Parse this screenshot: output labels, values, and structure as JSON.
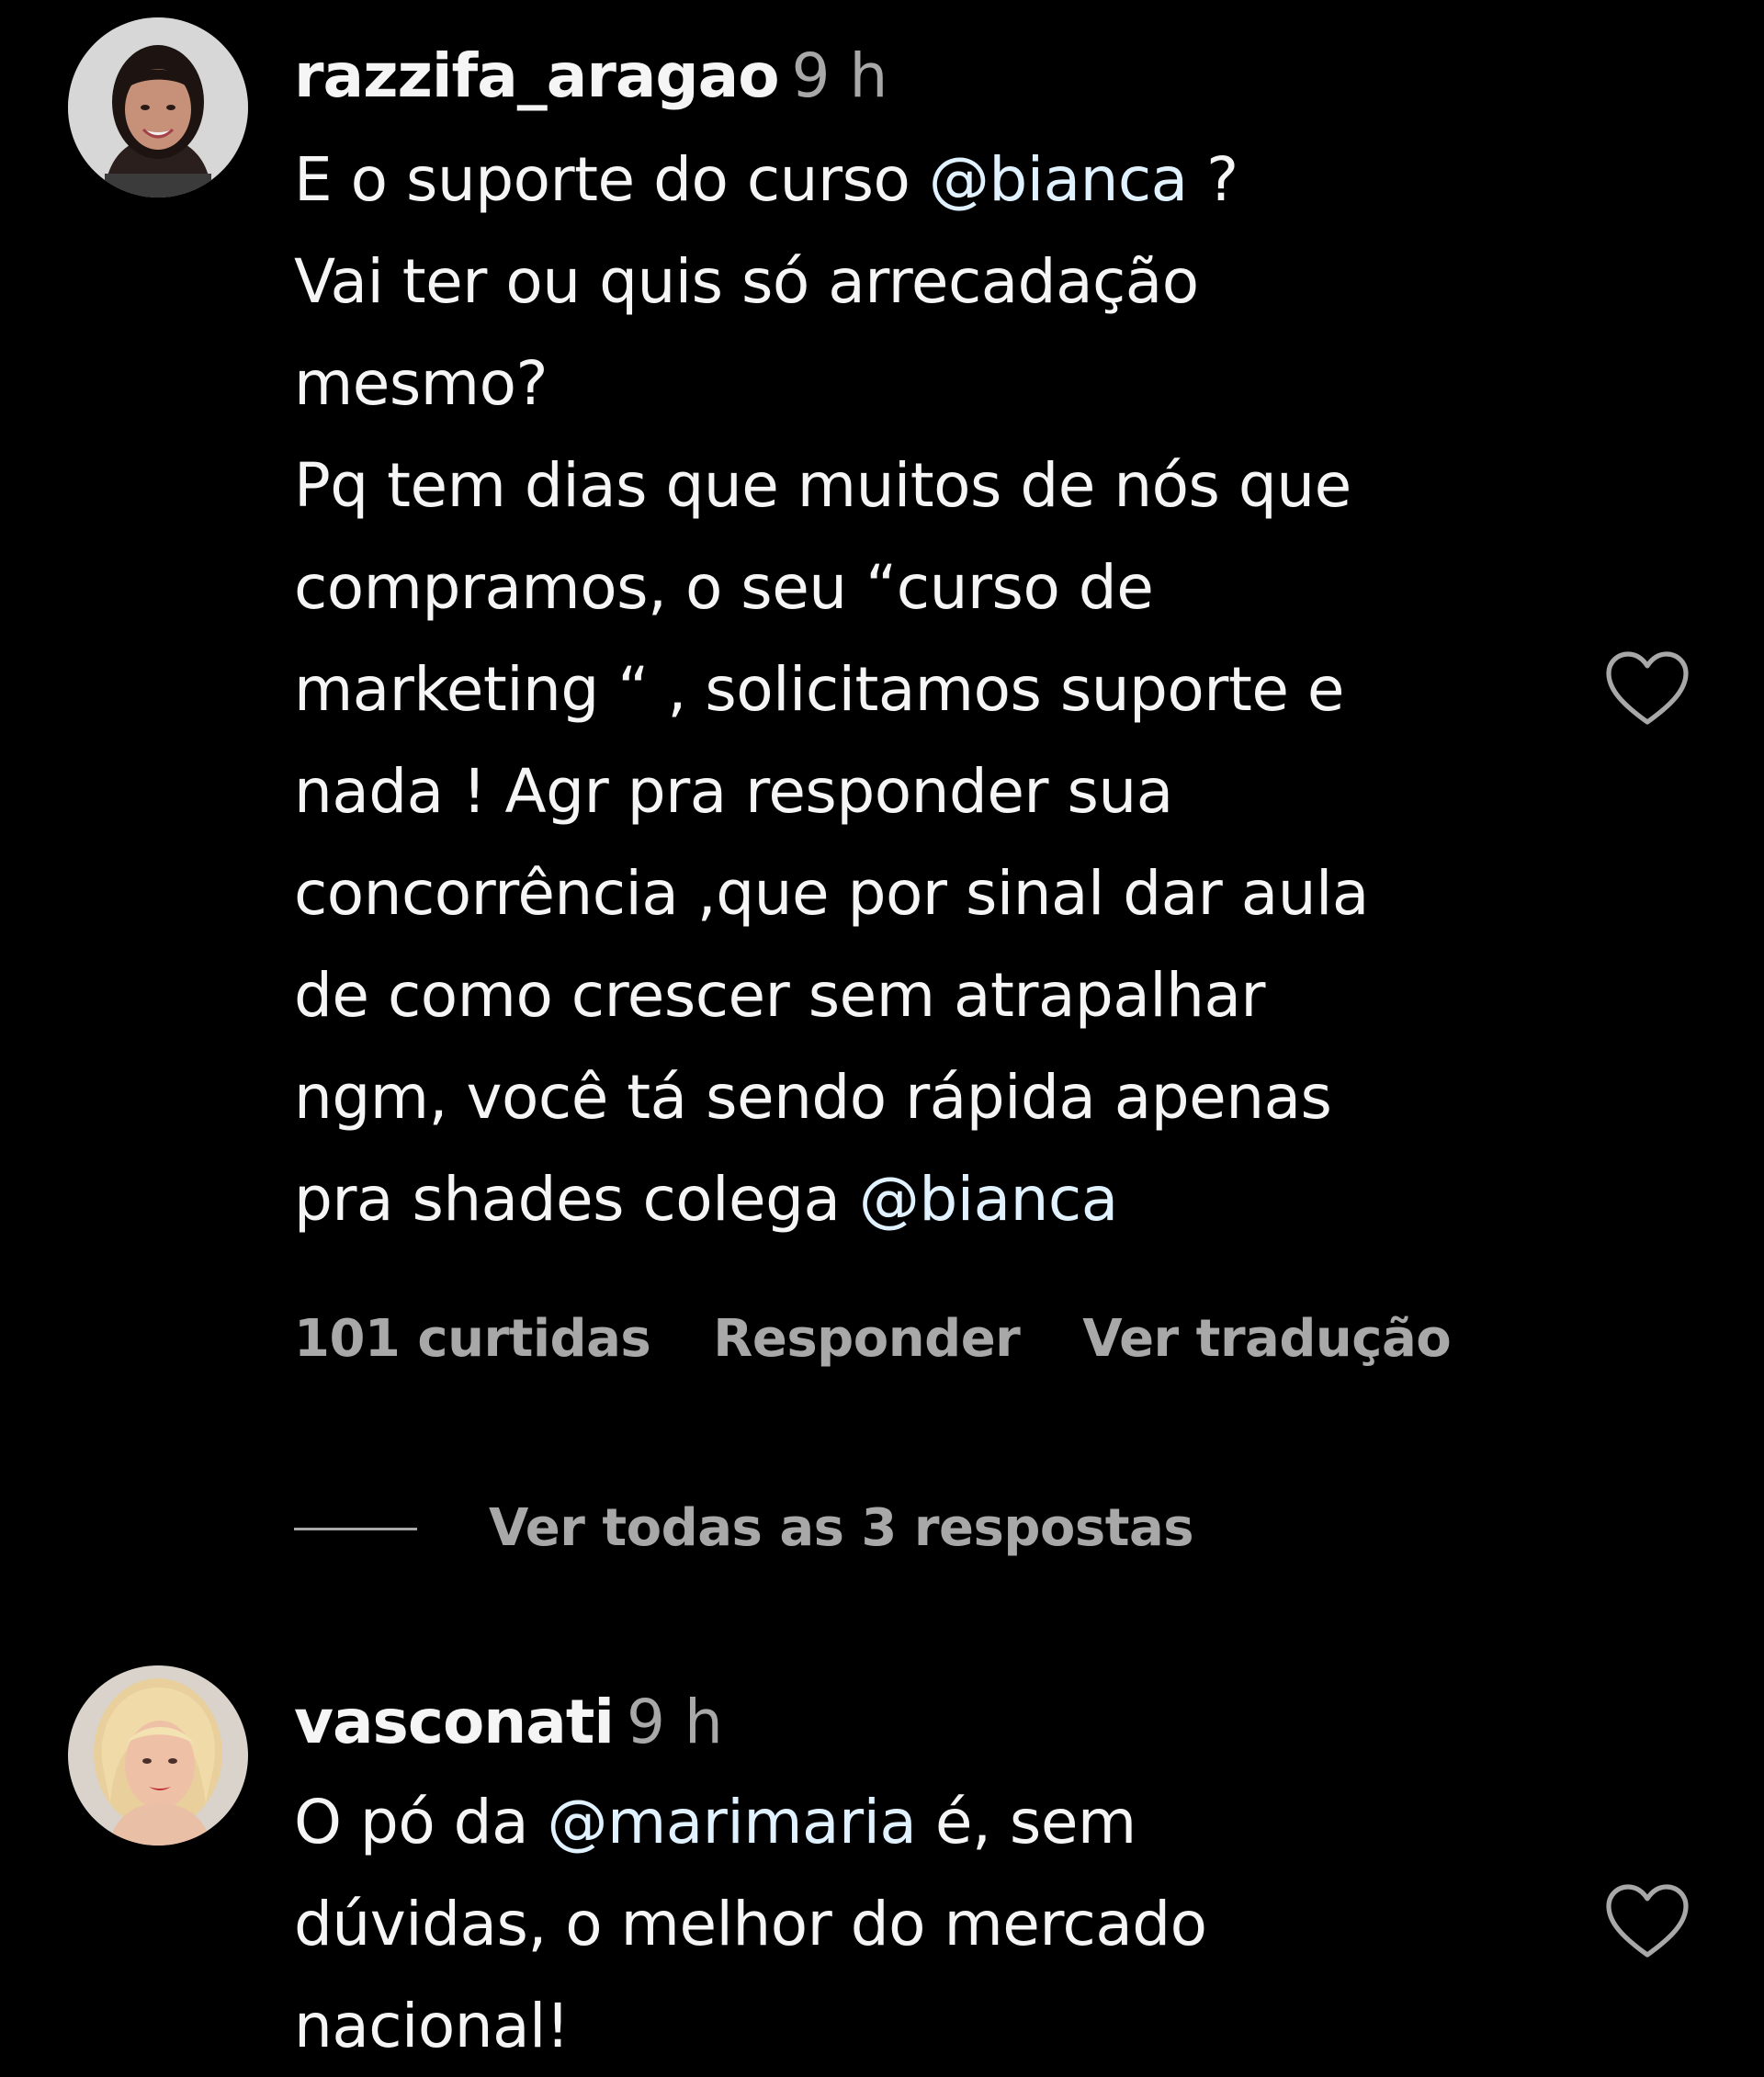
{
  "comments": [
    {
      "username": "razzifa_aragao",
      "time": "9 h",
      "avatar_icon": "user-avatar-photo",
      "lines": [
        [
          {
            "t": "E o suporte do curso "
          },
          {
            "t": "@bianca",
            "mention": true
          },
          {
            "t": " ?"
          }
        ],
        [
          {
            "t": "Vai ter ou quis só arrecadação"
          }
        ],
        [
          {
            "t": "mesmo?"
          }
        ],
        [
          {
            "t": "Pq tem dias que muitos de nós que"
          }
        ],
        [
          {
            "t": "compramos, o seu “curso de"
          }
        ],
        [
          {
            "t": "marketing “ , solicitamos suporte e"
          }
        ],
        [
          {
            "t": "nada ! Agr pra responder sua"
          }
        ],
        [
          {
            "t": "concorrência ,que por sinal dar aula"
          }
        ],
        [
          {
            "t": "de como crescer sem atrapalhar"
          }
        ],
        [
          {
            "t": "ngm, você tá sendo rápida apenas"
          }
        ],
        [
          {
            "t": "pra shades colega "
          },
          {
            "t": "@bianca",
            "mention": true
          }
        ]
      ],
      "likes": "101 curtidas",
      "reply": "Responder",
      "translate": "Ver tradução",
      "view_replies": "Ver todas as 3 respostas",
      "like_icon": "heart-outline-icon"
    },
    {
      "username": "vasconati",
      "time": "9 h",
      "avatar_icon": "user-avatar-photo",
      "lines": [
        [
          {
            "t": "O pó da "
          },
          {
            "t": "@marimaria",
            "mention": true
          },
          {
            "t": " é, sem"
          }
        ],
        [
          {
            "t": "dúvidas, o melhor do mercado"
          }
        ],
        [
          {
            "t": "nacional!"
          }
        ]
      ],
      "like_icon": "heart-outline-icon"
    }
  ],
  "colors": {
    "background": "#000000",
    "text": "#f5f5f5",
    "secondary": "#a8a8a8",
    "mention": "#e0f1ff"
  }
}
